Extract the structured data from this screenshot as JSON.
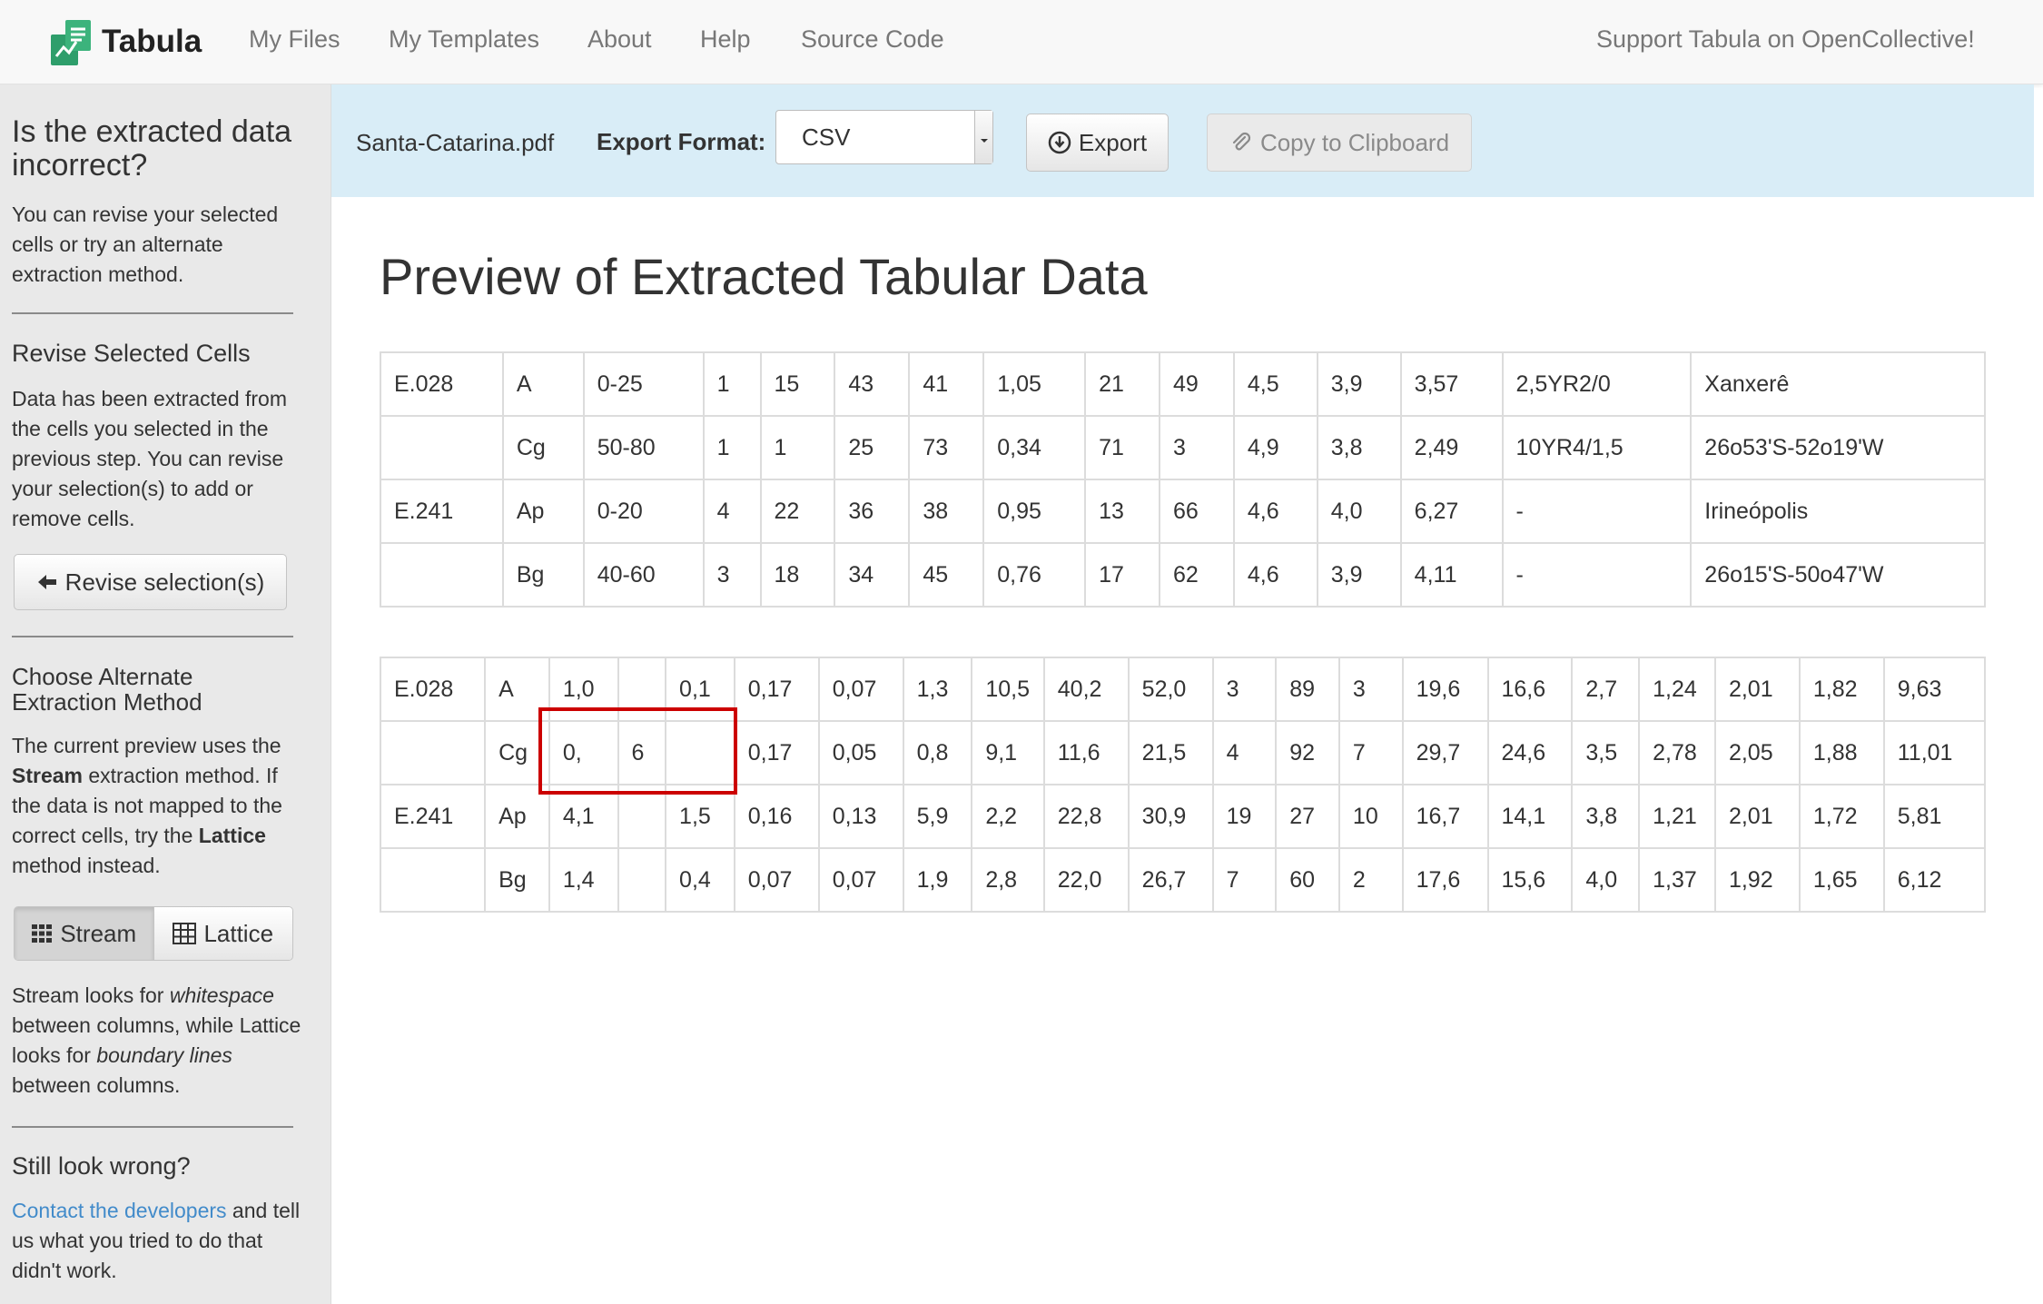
{
  "colors": {
    "navbar_bg": "#f8f8f8",
    "sidebar_bg": "#e9e9e9",
    "toolbar_bg": "#d9edf7",
    "link": "#428bca",
    "highlight": "#cc0000",
    "logo_green": "#2e9e6b"
  },
  "nav": {
    "brand": "Tabula",
    "links": [
      "My Files",
      "My Templates",
      "About",
      "Help",
      "Source Code"
    ],
    "support": "Support Tabula on OpenCollective!"
  },
  "sidebar": {
    "heading": "Is the extracted data incorrect?",
    "intro": "You can revise your selected cells or try an alternate extraction method.",
    "revise_heading": "Revise Selected Cells",
    "revise_text": "Data has been extracted from the cells you selected in the previous step. You can revise your selection(s) to add or remove cells.",
    "revise_button": "Revise selection(s)",
    "alt_heading": "Choose Alternate Extraction Method",
    "alt_text_1": "The current preview uses the ",
    "alt_text_bold_1": "Stream",
    "alt_text_2": " extraction method. If the data is not mapped to the correct cells, try the ",
    "alt_text_bold_2": "Lattice",
    "alt_text_3": " method instead.",
    "methods": {
      "stream": "Stream",
      "lattice": "Lattice",
      "active": "Stream"
    },
    "method_help_1": "Stream looks for ",
    "method_help_em_1": "whitespace",
    "method_help_2": " between columns, while Lattice looks for ",
    "method_help_em_2": "boundary lines",
    "method_help_3": " between columns.",
    "wrong_heading": "Still look wrong?",
    "contact_link": "Contact the developers",
    "contact_text": " and tell us what you tried to do that didn't work."
  },
  "toolbar": {
    "filename": "Santa-Catarina.pdf",
    "export_format_label": "Export Format:",
    "export_format_value": "CSV",
    "export_button": "Export",
    "copy_button": "Copy to Clipboard"
  },
  "main": {
    "title": "Preview of Extracted Tabular Data",
    "tables": [
      {
        "rows": [
          [
            "E.028",
            "A",
            "0-25",
            "1",
            "15",
            "43",
            "41",
            "1,05",
            "21",
            "49",
            "4,5",
            "3,9",
            "3,57",
            "2,5YR2/0",
            "Xanxerê"
          ],
          [
            "",
            "Cg",
            "50-80",
            "1",
            "1",
            "25",
            "73",
            "0,34",
            "71",
            "3",
            "4,9",
            "3,8",
            "2,49",
            "10YR4/1,5",
            "26o53'S-52o19'W"
          ],
          [
            "E.241",
            "Ap",
            "0-20",
            "4",
            "22",
            "36",
            "38",
            "0,95",
            "13",
            "66",
            "4,6",
            "4,0",
            "6,27",
            "-",
            "Irineópolis"
          ],
          [
            "",
            "Bg",
            "40-60",
            "3",
            "18",
            "34",
            "45",
            "0,76",
            "17",
            "62",
            "4,6",
            "3,9",
            "4,11",
            "-",
            "26o15'S-50o47'W"
          ]
        ]
      },
      {
        "rows": [
          [
            "E.028",
            "A",
            "1,0",
            "",
            "0,1",
            "0,17",
            "0,07",
            "1,3",
            "10,5",
            "40,2",
            "52,0",
            "3",
            "89",
            "3",
            "19,6",
            "16,6",
            "2,7",
            "1,24",
            "2,01",
            "1,82",
            "9,63"
          ],
          [
            "",
            "Cg",
            "0,",
            "6",
            "",
            "0,17",
            "0,05",
            "0,8",
            "9,1",
            "11,6",
            "21,5",
            "4",
            "92",
            "7",
            "29,7",
            "24,6",
            "3,5",
            "2,78",
            "2,05",
            "1,88",
            "11,01"
          ],
          [
            "E.241",
            "Ap",
            "4,1",
            "",
            "1,5",
            "0,16",
            "0,13",
            "5,9",
            "2,2",
            "22,8",
            "30,9",
            "19",
            "27",
            "10",
            "16,7",
            "14,1",
            "3,8",
            "1,21",
            "2,01",
            "1,72",
            "5,81"
          ],
          [
            "",
            "Bg",
            "1,4",
            "",
            "0,4",
            "0,07",
            "0,07",
            "1,9",
            "2,8",
            "22,0",
            "26,7",
            "7",
            "60",
            "2",
            "17,6",
            "15,6",
            "4,0",
            "1,37",
            "1,92",
            "1,65",
            "6,12"
          ]
        ]
      }
    ]
  }
}
